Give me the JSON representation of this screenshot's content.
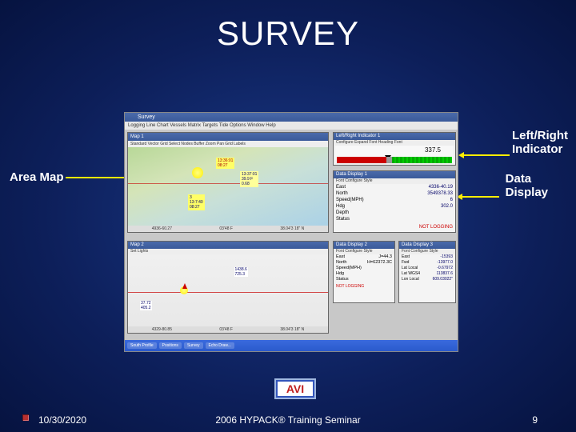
{
  "title": "SURVEY",
  "labels": {
    "area_map": "Area Map",
    "lr_indicator": "Left/Right\nIndicator",
    "data_display": "Data\nDisplay"
  },
  "avi_button": "AVI",
  "footer": {
    "date": "10/30/2020",
    "center": "2006 HYPACK® Training Seminar",
    "page": "9"
  },
  "screenshot": {
    "app_title": "Survey",
    "app_menu": "Logging  Line  Chart  Vessels  Matrix  Targets  Tide  Options  Window  Help",
    "map1": {
      "title": "Map 1",
      "menu": "Standard  Vector  Grid  Select  Nodes  Buffer  Zoom  Pan  Grid  Labels",
      "tag1": "13:36:01\n08:27",
      "tag2": "13:37:01\n39.9 F\n0.68",
      "tag3": "3\n13:7:40\n08:27",
      "status": [
        "4936-60.27",
        "03'48 F",
        "38.04'3 18\" N"
      ]
    },
    "lr": {
      "title": "Left/Right Indicator 1",
      "menu": "Configure  Expand  Font  Heading Font",
      "value": "337.5"
    },
    "dd1": {
      "title": "Data Display 1",
      "menu": "Font  Configure  Style",
      "rows": [
        {
          "k": "East",
          "v": "4336-40.19"
        },
        {
          "k": "North",
          "v": "3549378.33"
        },
        {
          "k": "Speed(MPH)",
          "v": "6"
        },
        {
          "k": "Hdg",
          "v": "302.0"
        },
        {
          "k": "Depth",
          "v": ""
        },
        {
          "k": "Status",
          "v": ""
        }
      ],
      "notlog": "NOT LOGGING"
    },
    "map2": {
      "title": "Map 2",
      "menu": "Set  Lights",
      "tagA": "37.72\n405.2",
      "tagB": "1438.6\n725.3",
      "status": [
        "4329-80.85",
        "03'48 F",
        "38.04'3 18\" N"
      ]
    },
    "dd2": {
      "title": "Data Display 2",
      "menu": "Font  Configure  Style",
      "rows": [
        {
          "k": "East",
          "v": "J=44.3"
        },
        {
          "k": "North",
          "v": "H=62372.3C"
        },
        {
          "k": "Speed(MPH)",
          "v": ""
        },
        {
          "k": "Hdg",
          "v": ""
        },
        {
          "k": "Status",
          "v": ""
        }
      ],
      "notlog": "NOT LOGGING"
    },
    "dd3": {
      "title": "Data Display 3",
      "menu": "Font  Configure  Style",
      "rows": [
        {
          "k": "East",
          "v": "-15393"
        },
        {
          "k": "Fwd",
          "v": "-13977.0"
        },
        {
          "k": "Lat Local",
          "v": "-0.67972"
        },
        {
          "k": "Lat WGS4",
          "v": "113837.6"
        },
        {
          "k": "Lon Local",
          "v": "609.03022\""
        }
      ]
    },
    "taskbar": [
      "South Profile",
      "Positions",
      "Survey",
      "Echo Draw..."
    ]
  }
}
